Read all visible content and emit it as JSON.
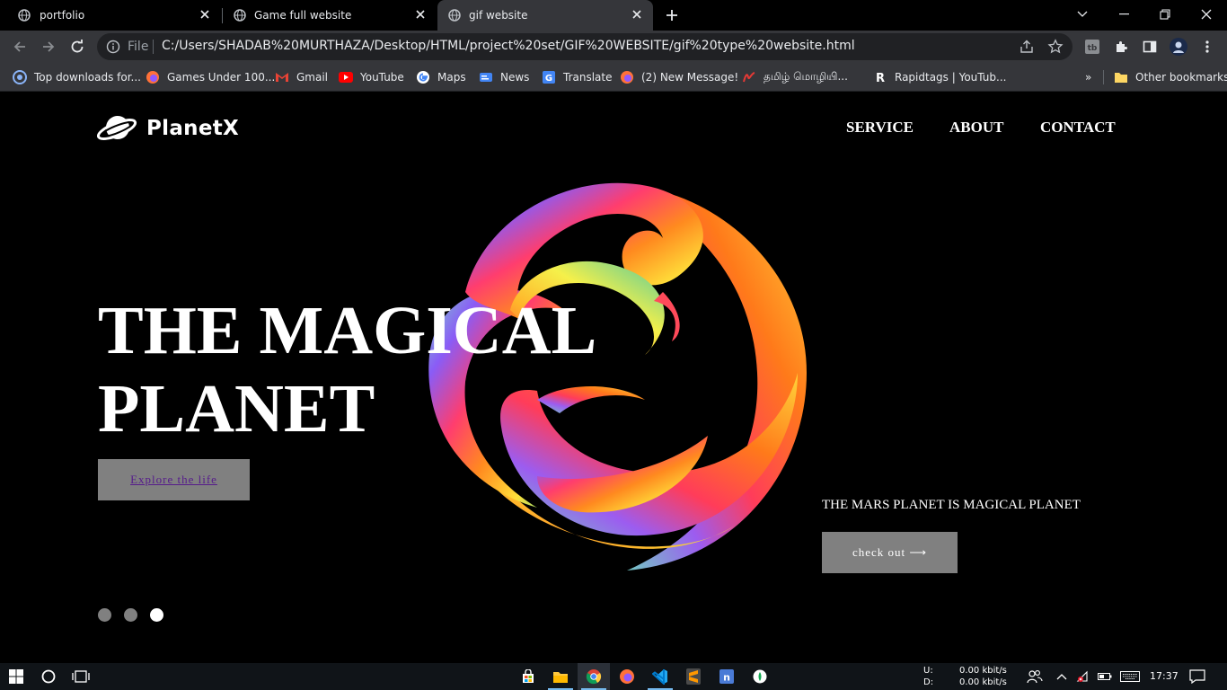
{
  "browser": {
    "tabs": [
      {
        "title": "portfolio",
        "active": false
      },
      {
        "title": "Game full website",
        "active": false
      },
      {
        "title": "gif website",
        "active": true
      }
    ],
    "omnibox": {
      "scheme_label": "File",
      "url": "C:/Users/SHADAB%20MURTHAZA/Desktop/HTML/project%20set/GIF%20WEBSITE/gif%20type%20website.html"
    },
    "bookmarks": [
      {
        "label": "Top downloads for...",
        "icon": "softonic-icon"
      },
      {
        "label": "Games Under 100...",
        "icon": "firefox-icon"
      },
      {
        "label": "Gmail",
        "icon": "gmail-icon"
      },
      {
        "label": "YouTube",
        "icon": "youtube-icon"
      },
      {
        "label": "Maps",
        "icon": "google-icon"
      },
      {
        "label": "News",
        "icon": "news-icon"
      },
      {
        "label": "Translate",
        "icon": "translate-icon"
      },
      {
        "label": "(2) New Message!",
        "icon": "firefox-icon"
      },
      {
        "label": "தமிழ் மொழியி...",
        "icon": "tamil-site-icon"
      },
      {
        "label": "Rapidtags | YouTub...",
        "icon": "rapidtags-icon"
      }
    ],
    "other_bookmarks": "Other bookmarks",
    "more_bookmarks": "»"
  },
  "site": {
    "brand": "PlanetX",
    "nav": [
      "SERVICE",
      "ABOUT",
      "CONTACT"
    ],
    "hero_line1": "THE MAGICAL",
    "hero_line2": "PLANET",
    "explore_button": "Explore the life",
    "tagline": "THE MARS PLANET IS MAGICAL PLANET",
    "checkout_button": "check out ⟶",
    "slides": {
      "count": 3,
      "active": 3
    }
  },
  "taskbar": {
    "net_up_label": "U:",
    "net_up_value": "0.00 kbit/s",
    "net_down_label": "D:",
    "net_down_value": "0.00 kbit/s",
    "time": "17:37",
    "apps": [
      "store-icon",
      "file-explorer-icon",
      "chrome-icon",
      "firefox-icon",
      "vscode-icon",
      "sublime-icon",
      "notion-icon",
      "mongodb-icon"
    ]
  },
  "colors": {
    "page_bg": "#000000",
    "button_bg": "#808080",
    "link_visited": "#551a8b",
    "chrome_dark": "#35363a"
  }
}
